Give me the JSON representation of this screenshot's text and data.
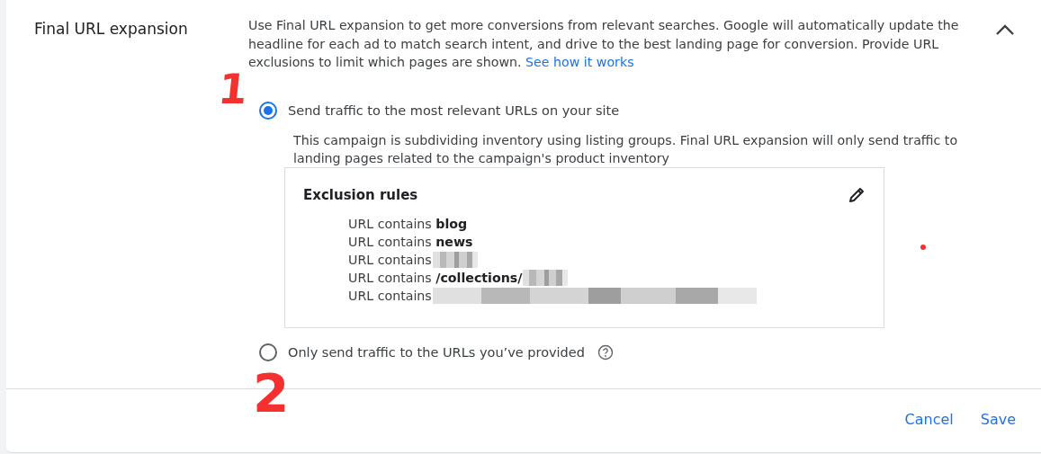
{
  "section": {
    "title": "Final URL expansion",
    "expanded": true,
    "description": "Use Final URL expansion to get more conversions from relevant searches. Google will automatically update the headline for each ad to match search intent, and drive to the best landing page for conversion. Provide URL exclusions to limit which pages are shown.",
    "link": "See how it works"
  },
  "options": [
    {
      "label": "Send traffic to the most relevant URLs on your site",
      "selected": true,
      "help": false,
      "note": "This campaign is subdividing inventory using listing groups. Final URL expansion will only send traffic to landing pages related to the campaign's product inventory"
    },
    {
      "label": "Only send traffic to the URLs you’ve provided",
      "selected": false,
      "help": true
    }
  ],
  "exclusions": {
    "title": "Exclusion rules",
    "rules": [
      {
        "prefix": "URL contains",
        "value": "blog",
        "redacted": false
      },
      {
        "prefix": "URL contains",
        "value": "news",
        "redacted": false
      },
      {
        "prefix": "URL contains",
        "redacted": true
      },
      {
        "prefix": "URL contains",
        "value": "/collections/",
        "redacted": true
      },
      {
        "prefix": "URL contains",
        "redacted": true
      }
    ]
  },
  "buttons": [
    {
      "label": "Cancel"
    },
    {
      "label": "Save"
    }
  ],
  "annotations": [
    {
      "kind": "number",
      "text": "1"
    },
    {
      "kind": "number",
      "text": "2"
    },
    {
      "kind": "dot"
    }
  ]
}
